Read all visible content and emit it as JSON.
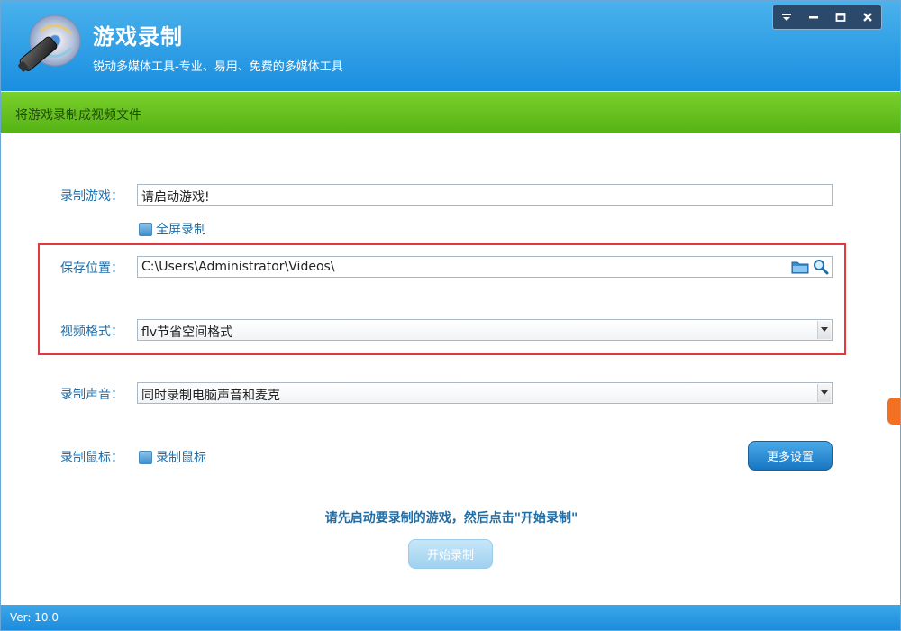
{
  "app": {
    "title": "游戏录制",
    "subtitle": "锐动多媒体工具-专业、易用、免费的多媒体工具"
  },
  "window_controls": {
    "icons": [
      "dropdown-icon",
      "minimize-icon",
      "maximize-icon",
      "close-icon"
    ]
  },
  "banner": {
    "text": "将游戏录制成视频文件"
  },
  "form": {
    "game": {
      "label": "录制游戏：",
      "value": "请启动游戏!"
    },
    "fullscreen": {
      "label": "全屏录制",
      "checked": false
    },
    "save_location": {
      "label": "保存位置：",
      "value": "C:\\Users\\Administrator\\Videos\\"
    },
    "video_format": {
      "label": "视频格式：",
      "value": "flv节省空间格式"
    },
    "audio": {
      "label": "录制声音：",
      "value": "同时录制电脑声音和麦克"
    },
    "mouse": {
      "label": "录制鼠标：",
      "checkbox_label": "录制鼠标",
      "checked": false
    }
  },
  "buttons": {
    "more_settings": "更多设置",
    "start_recording": "开始录制"
  },
  "hint": "请先启动要录制的游戏，然后点击\"开始录制\"",
  "footer": {
    "version": "Ver: 10.0"
  },
  "colors": {
    "header": "#1a8ee0",
    "banner": "#55b214",
    "label": "#1f6ea8",
    "highlight": "#e0393e"
  }
}
